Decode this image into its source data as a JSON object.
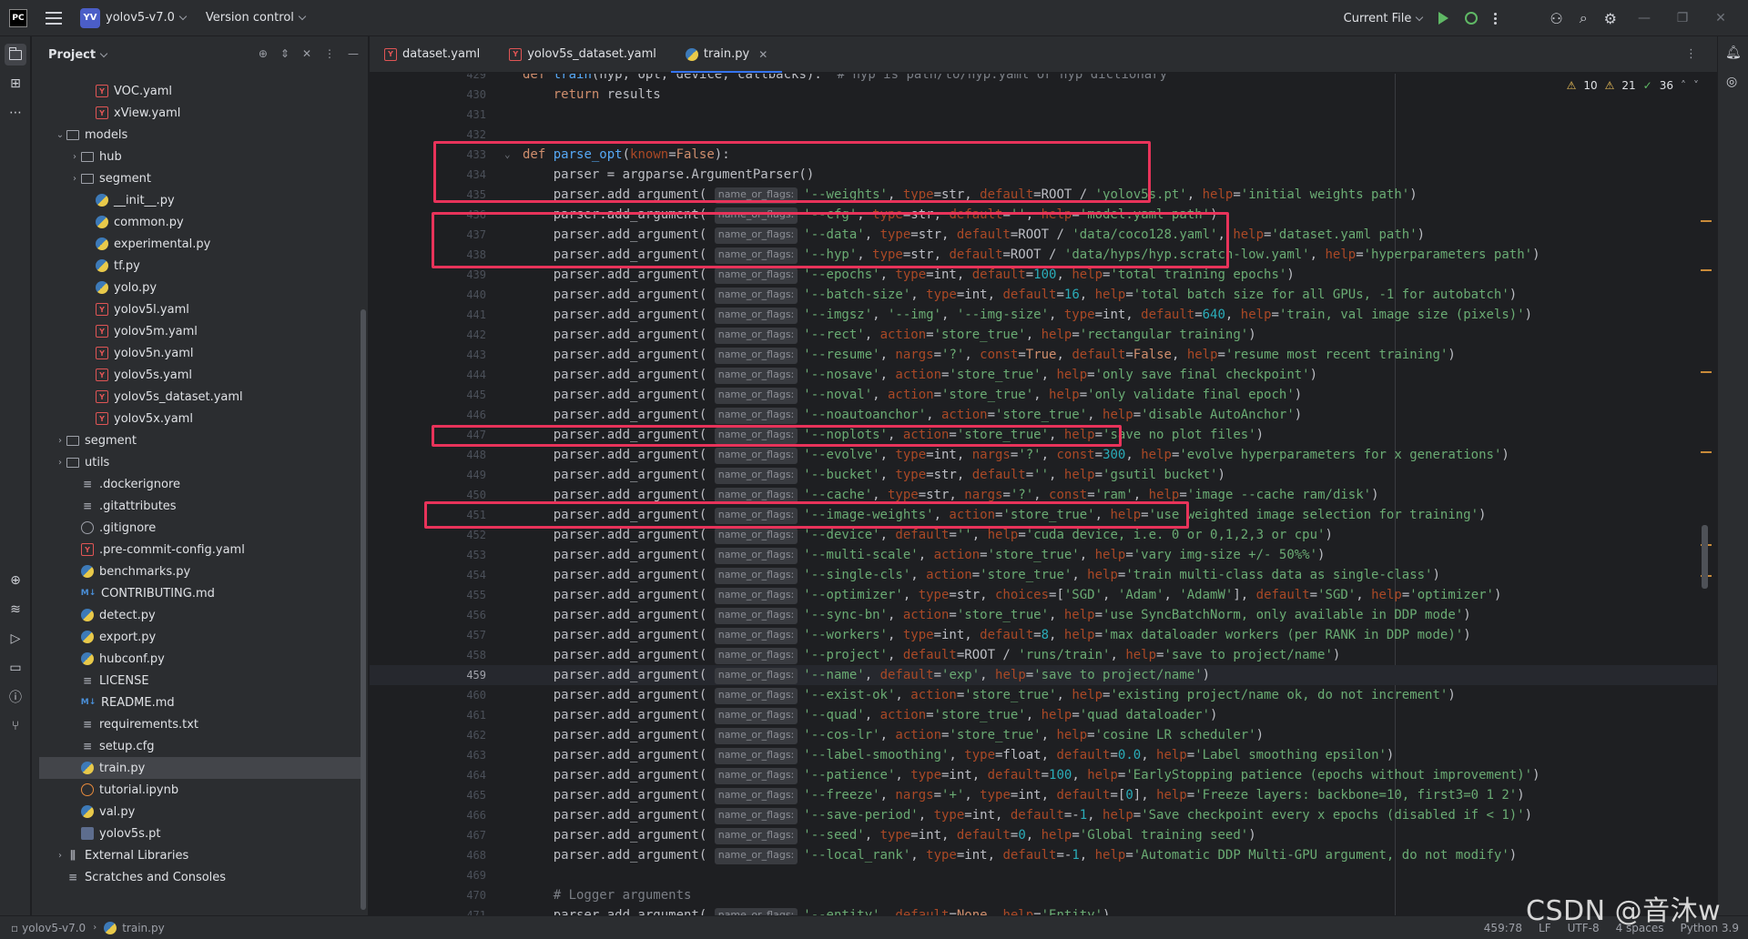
{
  "titlebar": {
    "logo": "PC",
    "project_badge": "YV",
    "project_name": "yolov5-v7.0",
    "vcs": "Version control",
    "run_config": "Current File"
  },
  "project_panel": {
    "title": "Project",
    "items": [
      {
        "label": "VOC.yaml",
        "icon": "yaml",
        "indent": 3,
        "arrow": ""
      },
      {
        "label": "xView.yaml",
        "icon": "yaml",
        "indent": 3,
        "arrow": ""
      },
      {
        "label": "models",
        "icon": "folder",
        "indent": 1,
        "arrow": "open"
      },
      {
        "label": "hub",
        "icon": "folder",
        "indent": 2,
        "arrow": "closed"
      },
      {
        "label": "segment",
        "icon": "folder",
        "indent": 2,
        "arrow": "closed"
      },
      {
        "label": "__init__.py",
        "icon": "py",
        "indent": 3,
        "arrow": ""
      },
      {
        "label": "common.py",
        "icon": "py",
        "indent": 3,
        "arrow": ""
      },
      {
        "label": "experimental.py",
        "icon": "py",
        "indent": 3,
        "arrow": ""
      },
      {
        "label": "tf.py",
        "icon": "py",
        "indent": 3,
        "arrow": ""
      },
      {
        "label": "yolo.py",
        "icon": "py",
        "indent": 3,
        "arrow": ""
      },
      {
        "label": "yolov5l.yaml",
        "icon": "yaml",
        "indent": 3,
        "arrow": ""
      },
      {
        "label": "yolov5m.yaml",
        "icon": "yaml",
        "indent": 3,
        "arrow": ""
      },
      {
        "label": "yolov5n.yaml",
        "icon": "yaml",
        "indent": 3,
        "arrow": ""
      },
      {
        "label": "yolov5s.yaml",
        "icon": "yaml",
        "indent": 3,
        "arrow": ""
      },
      {
        "label": "yolov5s_dataset.yaml",
        "icon": "yaml",
        "indent": 3,
        "arrow": ""
      },
      {
        "label": "yolov5x.yaml",
        "icon": "yaml",
        "indent": 3,
        "arrow": ""
      },
      {
        "label": "segment",
        "icon": "folder",
        "indent": 1,
        "arrow": "closed"
      },
      {
        "label": "utils",
        "icon": "folder",
        "indent": 1,
        "arrow": "closed"
      },
      {
        "label": ".dockerignore",
        "icon": "text",
        "indent": 2,
        "arrow": ""
      },
      {
        "label": ".gitattributes",
        "icon": "text",
        "indent": 2,
        "arrow": ""
      },
      {
        "label": ".gitignore",
        "icon": "ban",
        "indent": 2,
        "arrow": ""
      },
      {
        "label": ".pre-commit-config.yaml",
        "icon": "yaml",
        "indent": 2,
        "arrow": ""
      },
      {
        "label": "benchmarks.py",
        "icon": "py",
        "indent": 2,
        "arrow": ""
      },
      {
        "label": "CONTRIBUTING.md",
        "icon": "md",
        "indent": 2,
        "arrow": ""
      },
      {
        "label": "detect.py",
        "icon": "py",
        "indent": 2,
        "arrow": ""
      },
      {
        "label": "export.py",
        "icon": "py",
        "indent": 2,
        "arrow": ""
      },
      {
        "label": "hubconf.py",
        "icon": "py",
        "indent": 2,
        "arrow": ""
      },
      {
        "label": "LICENSE",
        "icon": "text",
        "indent": 2,
        "arrow": ""
      },
      {
        "label": "README.md",
        "icon": "md",
        "indent": 2,
        "arrow": ""
      },
      {
        "label": "requirements.txt",
        "icon": "text",
        "indent": 2,
        "arrow": ""
      },
      {
        "label": "setup.cfg",
        "icon": "text",
        "indent": 2,
        "arrow": ""
      },
      {
        "label": "train.py",
        "icon": "py",
        "indent": 2,
        "arrow": "",
        "selected": true
      },
      {
        "label": "tutorial.ipynb",
        "icon": "nb",
        "indent": 2,
        "arrow": ""
      },
      {
        "label": "val.py",
        "icon": "py",
        "indent": 2,
        "arrow": ""
      },
      {
        "label": "yolov5s.pt",
        "icon": "pt",
        "indent": 2,
        "arrow": ""
      },
      {
        "label": "External Libraries",
        "icon": "lib",
        "indent": 1,
        "arrow": "closed"
      },
      {
        "label": "Scratches and Consoles",
        "icon": "text",
        "indent": 1,
        "arrow": ""
      }
    ]
  },
  "tabs": [
    {
      "label": "dataset.yaml",
      "icon": "yaml",
      "active": false
    },
    {
      "label": "yolov5s_dataset.yaml",
      "icon": "yaml",
      "active": false
    },
    {
      "label": "train.py",
      "icon": "py",
      "active": true
    }
  ],
  "inspections": {
    "warnings": "10",
    "weak_warnings": "21",
    "ok": "36"
  },
  "editor": {
    "hint": "name_or_flags:",
    "current_line": 459,
    "lines": [
      {
        "n": "429",
        "t": "def train(hyp, opt, device, callbacks):  # hyp is path/to/hyp.yaml or hyp dictionary"
      },
      {
        "n": "430",
        "t": "    return results"
      },
      {
        "n": "431",
        "t": ""
      },
      {
        "n": "432",
        "t": ""
      },
      {
        "n": "433",
        "t": "def parse_opt(known=False):"
      },
      {
        "n": "434",
        "t": "    parser = argparse.ArgumentParser()"
      },
      {
        "n": "435",
        "a": "'--weights', type=str, default=ROOT / 'yolov5s.pt', help='initial weights path')"
      },
      {
        "n": "436",
        "a": "'--cfg', type=str, default='', help='model.yaml path')"
      },
      {
        "n": "437",
        "a": "'--data', type=str, default=ROOT / 'data/coco128.yaml', help='dataset.yaml path')"
      },
      {
        "n": "438",
        "a": "'--hyp', type=str, default=ROOT / 'data/hyps/hyp.scratch-low.yaml', help='hyperparameters path')"
      },
      {
        "n": "439",
        "a": "'--epochs', type=int, default=100, help='total training epochs')"
      },
      {
        "n": "440",
        "a": "'--batch-size', type=int, default=16, help='total batch size for all GPUs, -1 for autobatch')"
      },
      {
        "n": "441",
        "a": "'--imgsz', '--img', '--img-size', type=int, default=640, help='train, val image size (pixels)')"
      },
      {
        "n": "442",
        "a": "'--rect', action='store_true', help='rectangular training')"
      },
      {
        "n": "443",
        "a": "'--resume', nargs='?', const=True, default=False, help='resume most recent training')"
      },
      {
        "n": "444",
        "a": "'--nosave', action='store_true', help='only save final checkpoint')"
      },
      {
        "n": "445",
        "a": "'--noval', action='store_true', help='only validate final epoch')"
      },
      {
        "n": "446",
        "a": "'--noautoanchor', action='store_true', help='disable AutoAnchor')"
      },
      {
        "n": "447",
        "a": "'--noplots', action='store_true', help='save no plot files')"
      },
      {
        "n": "448",
        "a": "'--evolve', type=int, nargs='?', const=300, help='evolve hyperparameters for x generations')"
      },
      {
        "n": "449",
        "a": "'--bucket', type=str, default='', help='gsutil bucket')"
      },
      {
        "n": "450",
        "a": "'--cache', type=str, nargs='?', const='ram', help='image --cache ram/disk')"
      },
      {
        "n": "451",
        "a": "'--image-weights', action='store_true', help='use weighted image selection for training')"
      },
      {
        "n": "452",
        "a": "'--device', default='', help='cuda device, i.e. 0 or 0,1,2,3 or cpu')"
      },
      {
        "n": "453",
        "a": "'--multi-scale', action='store_true', help='vary img-size +/- 50%%')"
      },
      {
        "n": "454",
        "a": "'--single-cls', action='store_true', help='train multi-class data as single-class')"
      },
      {
        "n": "455",
        "a": "'--optimizer', type=str, choices=['SGD', 'Adam', 'AdamW'], default='SGD', help='optimizer')"
      },
      {
        "n": "456",
        "a": "'--sync-bn', action='store_true', help='use SyncBatchNorm, only available in DDP mode')"
      },
      {
        "n": "457",
        "a": "'--workers', type=int, default=8, help='max dataloader workers (per RANK in DDP mode)')"
      },
      {
        "n": "458",
        "a": "'--project', default=ROOT / 'runs/train', help='save to project/name')"
      },
      {
        "n": "459",
        "a": "'--name', default='exp', help='save to project/name')"
      },
      {
        "n": "460",
        "a": "'--exist-ok', action='store_true', help='existing project/name ok, do not increment')"
      },
      {
        "n": "461",
        "a": "'--quad', action='store_true', help='quad dataloader')"
      },
      {
        "n": "462",
        "a": "'--cos-lr', action='store_true', help='cosine LR scheduler')"
      },
      {
        "n": "463",
        "a": "'--label-smoothing', type=float, default=0.0, help='Label smoothing epsilon')"
      },
      {
        "n": "464",
        "a": "'--patience', type=int, default=100, help='EarlyStopping patience (epochs without improvement)')"
      },
      {
        "n": "465",
        "a": "'--freeze', nargs='+', type=int, default=[0], help='Freeze layers: backbone=10, first3=0 1 2')"
      },
      {
        "n": "466",
        "a": "'--save-period', type=int, default=-1, help='Save checkpoint every x epochs (disabled if < 1)')"
      },
      {
        "n": "467",
        "a": "'--seed', type=int, default=0, help='Global training seed')"
      },
      {
        "n": "468",
        "a": "'--local_rank', type=int, default=-1, help='Automatic DDP Multi-GPU argument, do not modify')"
      },
      {
        "n": "469",
        "t": ""
      },
      {
        "n": "470",
        "t": "    # Logger arguments"
      },
      {
        "n": "471",
        "a": "'--entity', default=None, help='Entity')"
      }
    ]
  },
  "statusbar": {
    "breadcrumb_project": "yolov5-v7.0",
    "breadcrumb_file": "train.py",
    "position": "459:78",
    "line_sep": "LF",
    "encoding": "UTF-8",
    "indent": "4 spaces",
    "interpreter": "Python 3.9"
  },
  "watermark": "CSDN @音沐w",
  "colors": {
    "accent": "#3574f0",
    "highlight_box": "#e8335a",
    "keyword": "#cf8e6d",
    "string": "#6aab73",
    "number": "#2aacb8"
  }
}
